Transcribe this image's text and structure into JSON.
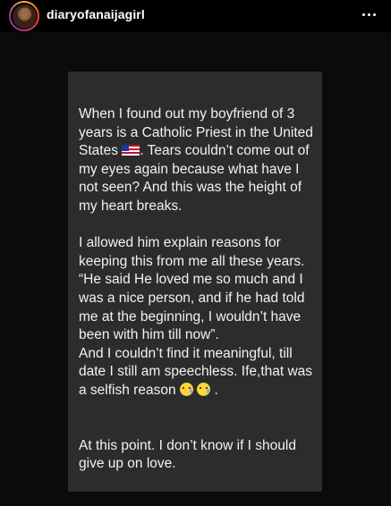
{
  "header": {
    "username": "diaryofanaijagirl",
    "more_icon": "more-horizontal-icon"
  },
  "post": {
    "paragraph1_a": "When I found out my boyfriend of 3 years is a Catholic Priest in the United States ",
    "paragraph1_flag": "us-flag-emoji",
    "paragraph1_b": ". Tears couldn’t come out of my eyes again because what have I not seen? And  this was the height of my heart breaks.",
    "paragraph2": "I allowed him explain reasons for keeping this from me all these years. “He said He loved me so much and I was a nice person, and if he had told me at the beginning, I wouldn’t  have been with him till now”.",
    "paragraph3": "And I couldn’t find it meaningful, till date I still am speechless. Ife,that was a selfish reason",
    "paragraph3_emojis": [
      "sad-relieved-face-emoji",
      "crying-face-emoji"
    ],
    "paragraph3_end": ".",
    "paragraph4": "At this point. I don’t know if I should give up on love."
  },
  "colors": {
    "background": "#000000",
    "card": "#2c2c2e",
    "text": "#f2f2f2"
  }
}
